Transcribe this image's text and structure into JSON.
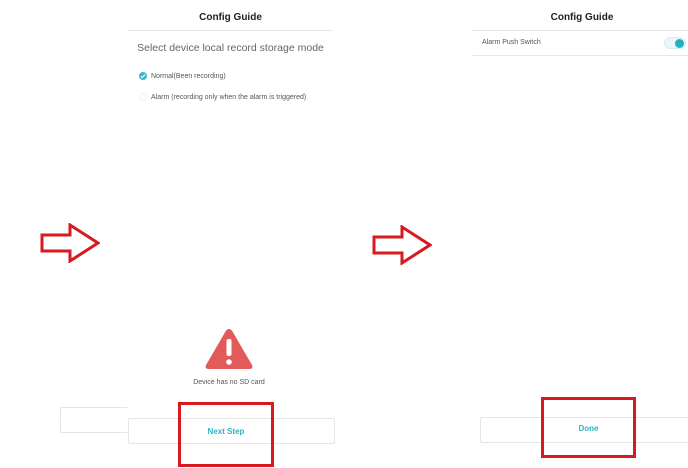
{
  "left_screen": {
    "title": "Config Guide",
    "heading": "Select device local record storage mode",
    "options": [
      {
        "label": "Normal(Been recording)",
        "selected": true
      },
      {
        "label": "Alarm (recording only when the alarm is triggered)",
        "selected": false
      }
    ],
    "warning_text": "Device has no SD card",
    "next_button": "Next Step"
  },
  "right_screen": {
    "title": "Config Guide",
    "alarm_push_label": "Alarm Push Switch",
    "alarm_push_on": true,
    "done_button": "Done"
  },
  "colors": {
    "accent": "#2fb3c4",
    "highlight": "#d71920",
    "warning": "#e35a5a"
  },
  "icons": {
    "arrow": "right-arrow-outline-icon",
    "warning": "warning-triangle-icon",
    "check": "check-icon"
  }
}
